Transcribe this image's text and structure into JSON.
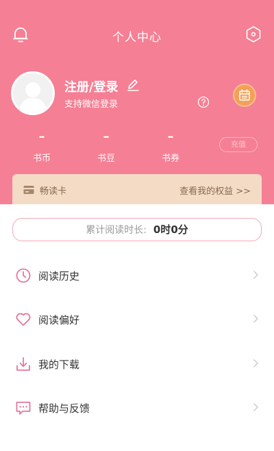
{
  "header": {
    "title": "个人中心"
  },
  "user": {
    "login_label": "注册/登录",
    "wechat_label": "支持微信登录"
  },
  "stats": [
    {
      "value": "–",
      "label": "书币"
    },
    {
      "value": "–",
      "label": "书豆"
    },
    {
      "value": "–",
      "label": "书券"
    }
  ],
  "recharge_label": "充值",
  "card": {
    "label": "畅读卡",
    "link": "查看我的权益 >>"
  },
  "reading": {
    "label": "累计阅读时长:",
    "value": "0时0分"
  },
  "menu": [
    {
      "label": "阅读历史",
      "icon": "clock-icon"
    },
    {
      "label": "阅读偏好",
      "icon": "heart-icon"
    },
    {
      "label": "我的下载",
      "icon": "download-icon"
    },
    {
      "label": "帮助与反馈",
      "icon": "feedback-icon"
    }
  ],
  "colors": {
    "header_pink": "#f57f94",
    "card_beige": "#f3dbc6",
    "accent_pink": "#e2789a",
    "calendar_orange": "#f5a057"
  }
}
